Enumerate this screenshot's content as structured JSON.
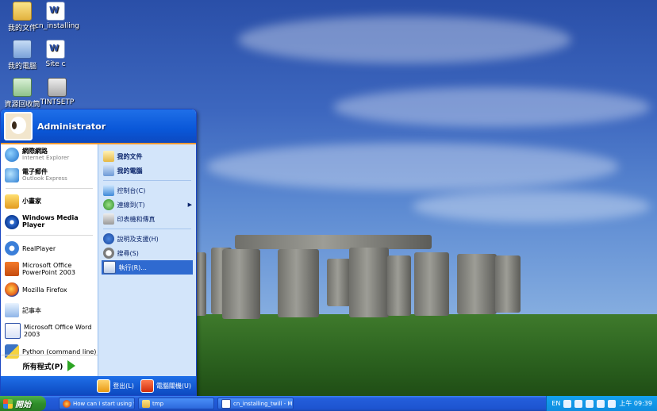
{
  "desktop": {
    "icons": [
      {
        "label": "我的文件"
      },
      {
        "label": "cn_installing"
      },
      {
        "label": "我的電腦"
      },
      {
        "label": "Site c"
      },
      {
        "label": "資源回收筒"
      },
      {
        "label": "TINTSETP"
      }
    ]
  },
  "start_menu": {
    "user": "Administrator",
    "pinned": [
      {
        "title": "網際網路",
        "subtitle": "Internet Explorer"
      },
      {
        "title": "電子郵件",
        "subtitle": "Outlook Express"
      }
    ],
    "recent": [
      {
        "label": "小畫家"
      },
      {
        "label": "Windows Media Player"
      },
      {
        "label": "RealPlayer"
      },
      {
        "label": "Microsoft Office PowerPoint 2003"
      },
      {
        "label": "Mozilla Firefox"
      },
      {
        "label": "記事本"
      },
      {
        "label": "Microsoft Office Word 2003"
      },
      {
        "label": "Python (command line)"
      }
    ],
    "all_programs": "所有程式(P)",
    "places": [
      {
        "label": "我的文件"
      },
      {
        "label": "我的電腦"
      },
      {
        "label": "控制台(C)"
      },
      {
        "label": "連線到(T)"
      },
      {
        "label": "印表機和傳真"
      },
      {
        "label": "說明及支援(H)"
      },
      {
        "label": "搜尋(S)"
      },
      {
        "label": "執行(R)..."
      }
    ],
    "logoff": "登出(L)",
    "shutdown": "電腦關機(U)"
  },
  "taskbar": {
    "start_label": "開始",
    "tasks": [
      {
        "label": "How can I start using t..."
      },
      {
        "label": "tmp"
      },
      {
        "label": "cn_installing_twill - M..."
      }
    ],
    "lang": "EN",
    "clock": "上午 09:39"
  }
}
